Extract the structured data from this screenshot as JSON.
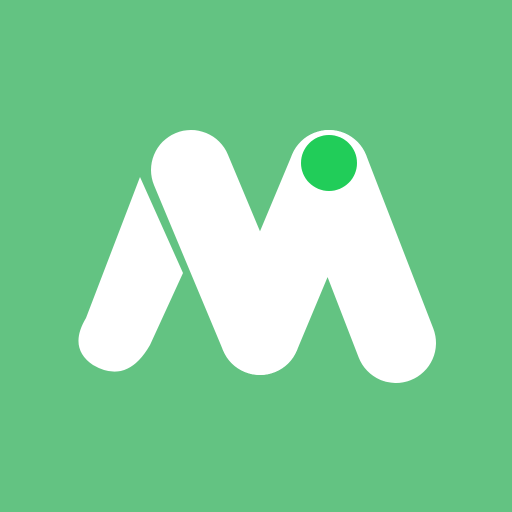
{
  "icon": {
    "name": "m-logo-icon",
    "colors": {
      "background": "#63C382",
      "letter": "#FFFFFF",
      "dot": "#21CD59"
    }
  }
}
